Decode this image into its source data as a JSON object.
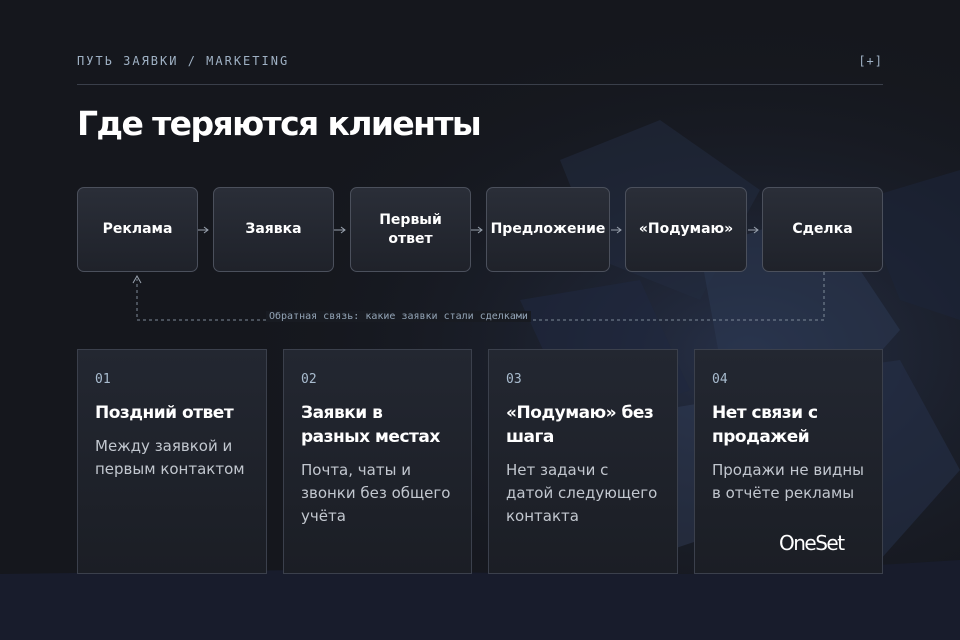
{
  "header": {
    "kicker": "ПУТЬ ЗАЯВКИ / MARKETING",
    "plus_label": "[+]",
    "title": "Где теряются клиенты"
  },
  "flow": {
    "steps": [
      {
        "lines": [
          "Реклама"
        ]
      },
      {
        "lines": [
          "Заявка"
        ]
      },
      {
        "lines": [
          "Первый",
          "ответ"
        ]
      },
      {
        "lines": [
          "Предложение"
        ]
      },
      {
        "lines": [
          "«Подумаю»"
        ]
      },
      {
        "lines": [
          "Сделка"
        ]
      }
    ],
    "feedback_label": "Обратная связь: какие заявки стали сделками"
  },
  "cards": [
    {
      "num": "01",
      "title": "Поздний ответ",
      "desc": "Между заявкой и первым контактом"
    },
    {
      "num": "02",
      "title": "Заявки в разных местах",
      "desc": "Почта, чаты и звонки без общего учёта"
    },
    {
      "num": "03",
      "title": "«Подумаю» без шага",
      "desc": "Нет задачи с датой следующего контакта"
    },
    {
      "num": "04",
      "title": "Нет связи с продажей",
      "desc": "Продажи не видны в отчёте рекламы"
    }
  ],
  "logo": {
    "text": "OneSet"
  },
  "colors": {
    "background": "#15171d",
    "accent_text": "#9fb1c4",
    "card_border": "#3b404c",
    "bottom_band": "#181c2c"
  }
}
